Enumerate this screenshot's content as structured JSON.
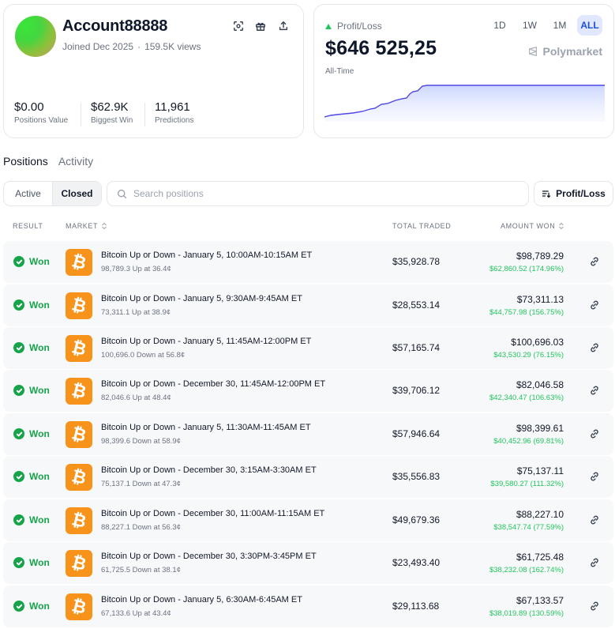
{
  "profile": {
    "username": "Account88888",
    "joined": "Joined Dec 2025",
    "views": "159.5K views",
    "stats": [
      {
        "value": "$0.00",
        "label": "Positions Value"
      },
      {
        "value": "$62.9K",
        "label": "Biggest Win"
      },
      {
        "value": "11,961",
        "label": "Predictions"
      }
    ]
  },
  "profit_loss": {
    "label": "Profit/Loss",
    "value": "$646 525,25",
    "range_label": "All-Time",
    "ranges": [
      "1D",
      "1W",
      "1M",
      "ALL"
    ],
    "active_range": "ALL",
    "brand": "Polymarket",
    "line_color": "#4f46e5"
  },
  "tabs": [
    "Positions",
    "Activity"
  ],
  "filter": {
    "active": "Active",
    "closed": "Closed"
  },
  "search": {
    "placeholder": "Search positions"
  },
  "sort_button": "Profit/Loss",
  "columns": {
    "result": "RESULT",
    "market": "MARKET",
    "total_traded": "TOTAL TRADED",
    "amount_won": "AMOUNT WON"
  },
  "rows": [
    {
      "result": "Won",
      "title": "Bitcoin Up or Down - January 5, 10:00AM-10:15AM ET",
      "sub": "98,789.3 Up at 36.4¢",
      "traded": "$35,928.78",
      "amount": "$98,789.29",
      "pnl": "$62,860.52 (174.96%)"
    },
    {
      "result": "Won",
      "title": "Bitcoin Up or Down - January 5, 9:30AM-9:45AM ET",
      "sub": "73,311.1 Up at 38.9¢",
      "traded": "$28,553.14",
      "amount": "$73,311.13",
      "pnl": "$44,757.98 (156.75%)"
    },
    {
      "result": "Won",
      "title": "Bitcoin Up or Down - January 5, 11:45AM-12:00PM ET",
      "sub": "100,696.0 Down at 56.8¢",
      "traded": "$57,165.74",
      "amount": "$100,696.03",
      "pnl": "$43,530.29 (76.15%)"
    },
    {
      "result": "Won",
      "title": "Bitcoin Up or Down - December 30, 11:45AM-12:00PM ET",
      "sub": "82,046.6 Up at 48.4¢",
      "traded": "$39,706.12",
      "amount": "$82,046.58",
      "pnl": "$42,340.47 (106.63%)"
    },
    {
      "result": "Won",
      "title": "Bitcoin Up or Down - January 5, 11:30AM-11:45AM ET",
      "sub": "98,399.6 Down at 58.9¢",
      "traded": "$57,946.64",
      "amount": "$98,399.61",
      "pnl": "$40,452.96 (69.81%)"
    },
    {
      "result": "Won",
      "title": "Bitcoin Up or Down - December 30, 3:15AM-3:30AM ET",
      "sub": "75,137.1 Down at 47.3¢",
      "traded": "$35,556.83",
      "amount": "$75,137.11",
      "pnl": "$39,580.27 (111.32%)"
    },
    {
      "result": "Won",
      "title": "Bitcoin Up or Down - December 30, 11:00AM-11:15AM ET",
      "sub": "88,227.1 Down at 56.3¢",
      "traded": "$49,679.36",
      "amount": "$88,227.10",
      "pnl": "$38,547.74 (77.59%)"
    },
    {
      "result": "Won",
      "title": "Bitcoin Up or Down - December 30, 3:30PM-3:45PM ET",
      "sub": "61,725.5 Down at 38.1¢",
      "traded": "$23,493.40",
      "amount": "$61,725.48",
      "pnl": "$38,232.08 (162.74%)"
    },
    {
      "result": "Won",
      "title": "Bitcoin Up or Down - January 5, 6:30AM-6:45AM ET",
      "sub": "67,133.6 Up at 43.4¢",
      "traded": "$29,113.68",
      "amount": "$67,133.57",
      "pnl": "$38,019.89 (130.59%)"
    }
  ]
}
